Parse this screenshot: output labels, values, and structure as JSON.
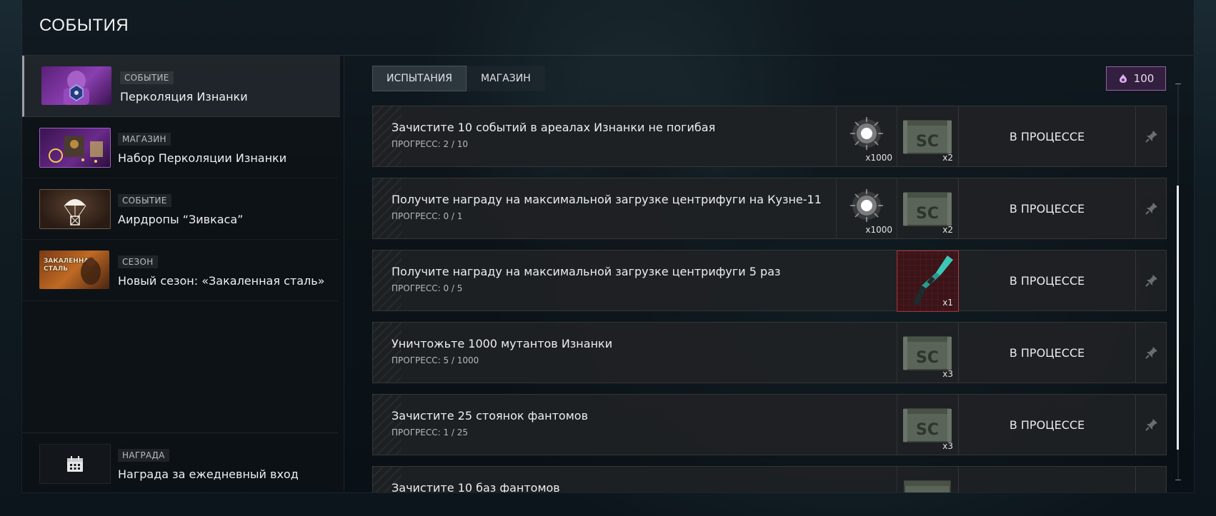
{
  "page": {
    "title": "СОБЫТИЯ"
  },
  "sidebar": {
    "items": [
      {
        "tag": "СОБЫТИЕ",
        "title": "Перколяция Изнанки"
      },
      {
        "tag": "МАГАЗИН",
        "title": "Набор Перколяции Изнанки"
      },
      {
        "tag": "СОБЫТИЕ",
        "title": "Аирдропы “Зивкаса”"
      },
      {
        "tag": "СЕЗОН",
        "title": "Новый сезон: «Закаленная сталь»",
        "thumb_text": "ЗАКАЛЕННАЯ СТАЛЬ"
      }
    ],
    "bottom": {
      "tag": "НАГРАДА",
      "title": "Награда за ежедневный вход"
    }
  },
  "tabs": {
    "challenges": "ИСПЫТАНИЯ",
    "shop": "МАГАЗИН"
  },
  "currency": {
    "amount": "100",
    "icon": "percolation-token-icon",
    "color": "#9b5fb0"
  },
  "challenges": [
    {
      "title": "Зачистите 10 событий в ареалах Изнанки не погибая",
      "progress": "ПРОГРЕСС: 2 / 10",
      "rewards": [
        {
          "icon": "glowing-orb-icon",
          "qty": "x1000"
        },
        {
          "icon": "sc-crate-icon",
          "qty": "x2"
        }
      ],
      "status": "В ПРОЦЕССЕ"
    },
    {
      "title": "Получите награду на максимальной загрузке центрифуги на Кузне-11",
      "progress": "ПРОГРЕСС: 0 / 1",
      "rewards": [
        {
          "icon": "glowing-orb-icon",
          "qty": "x1000"
        },
        {
          "icon": "sc-crate-icon",
          "qty": "x2"
        }
      ],
      "status": "В ПРОЦЕССЕ"
    },
    {
      "title": "Получите награду на максимальной загрузке центрифуги 5 раз",
      "progress": "ПРОГРЕСС: 0 / 5",
      "rewards": [
        {
          "icon": "weapon-skin-icon",
          "qty": "x1"
        }
      ],
      "status": "В ПРОЦЕССЕ"
    },
    {
      "title": "Уничтожьте 1000 мутантов Изнанки",
      "progress": "ПРОГРЕСС: 5 / 1000",
      "rewards": [
        {
          "icon": "sc-crate-icon",
          "qty": "x3"
        }
      ],
      "status": "В ПРОЦЕССЕ"
    },
    {
      "title": "Зачистите 25 стоянок фантомов",
      "progress": "ПРОГРЕСС: 1 / 25",
      "rewards": [
        {
          "icon": "sc-crate-icon",
          "qty": "x3"
        }
      ],
      "status": "В ПРОЦЕССЕ"
    },
    {
      "title": "Зачистите 10 баз фантомов",
      "progress": "",
      "rewards": [
        {
          "icon": "sc-crate-icon",
          "qty": ""
        }
      ],
      "status": ""
    }
  ]
}
